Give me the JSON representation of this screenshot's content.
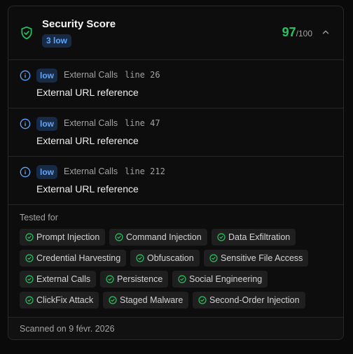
{
  "header": {
    "title": "Security Score",
    "low_count": "3 low",
    "score": "97",
    "score_max": "/100",
    "accent": "#22c55e"
  },
  "findings": [
    {
      "severity": "low",
      "category": "External Calls",
      "line": "line 26",
      "message": "External URL reference"
    },
    {
      "severity": "low",
      "category": "External Calls",
      "line": "line 47",
      "message": "External URL reference"
    },
    {
      "severity": "low",
      "category": "External Calls",
      "line": "line 212",
      "message": "External URL reference"
    }
  ],
  "tested": {
    "label": "Tested for",
    "items": [
      "Prompt Injection",
      "Command Injection",
      "Data Exfiltration",
      "Credential Harvesting",
      "Obfuscation",
      "Sensitive File Access",
      "External Calls",
      "Persistence",
      "Social Engineering",
      "ClickFix Attack",
      "Staged Malware",
      "Second-Order Injection"
    ]
  },
  "footer": {
    "scanned": "Scanned on 9 févr. 2026"
  }
}
